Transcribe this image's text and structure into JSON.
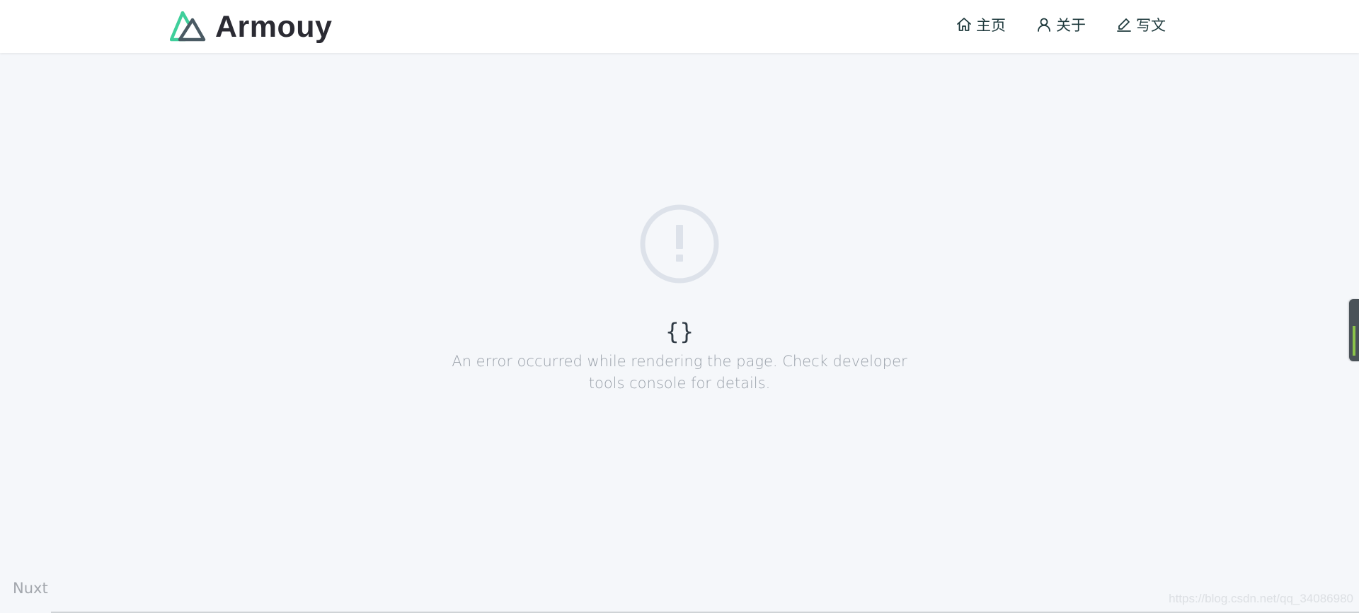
{
  "header": {
    "brand": "Armouy",
    "nav": [
      {
        "label": "主页",
        "icon": "home-icon"
      },
      {
        "label": "关于",
        "icon": "user-icon"
      },
      {
        "label": "写文",
        "icon": "edit-icon"
      }
    ]
  },
  "error": {
    "icon": "exclamation-circle-icon",
    "code": "{}",
    "message": "An error occurred while rendering the page. Check developer tools console for details."
  },
  "footer": {
    "link": "Nuxt"
  },
  "watermark": "https://blog.csdn.net/qq_34086980",
  "colors": {
    "logo_green": "#3fcf9b",
    "logo_dark": "#4a5a63",
    "icon_gray": "#dde2ea",
    "nav_text": "#1f3a3d"
  }
}
